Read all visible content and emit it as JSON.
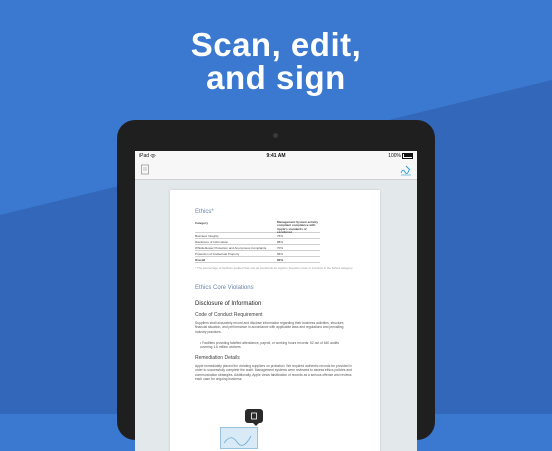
{
  "headline": {
    "line1": "Scan, edit,",
    "line2": "and sign"
  },
  "colors": {
    "background": "#3b78cf",
    "diagonal": "#3368bb",
    "accent": "#2a9fd6"
  },
  "status_bar": {
    "carrier": "iPad",
    "time": "9:41 AM",
    "battery": "100%"
  },
  "toolbar": {
    "left_icon": "document-icon",
    "right_icon": "signature-icon"
  },
  "document": {
    "section_title": "Ethics*",
    "table": {
      "col1_header": "Category",
      "col2_header": "Management System activity compliant compliance with Apple's standards of excellence",
      "rows": [
        {
          "category": "Business Integrity",
          "value": "75%"
        },
        {
          "category": "Disclosure of Information",
          "value": "88%"
        },
        {
          "category": "Whistleblower Protection and Anonymous Complaints",
          "value": "70%"
        },
        {
          "category": "Protection of Intellectual Property",
          "value": "95%"
        },
        {
          "category": "Overall",
          "value": "82%"
        }
      ]
    },
    "footnote": "* The percentage of facilities audited that met all standards for Apple's Supplier Code of Conduct in the Ethics category.",
    "violations_title": "Ethics Core Violations",
    "disclosure_title": "Disclosure of Information",
    "code_title": "Code of Conduct Requirement",
    "code_para": "Suppliers shall accurately record and disclose information regarding their business activities, structure, financial situation, and performance in accordance with applicable laws and regulations and prevailing industry practices.",
    "bullet": "Facilities providing falsified attendance, payroll, or working hours records: 52 out of 640 audits covering 1.6 million workers",
    "remediation_title": "Remediation Details",
    "remediation_para": "Apple immediately placed the violating suppliers on probation. We required authentic records be provided in order to successfully complete the audit. Management systems were reviewed to assess ethics policies and communication strategies. Additionally, Apple views falsification of records as a serious offense and reviews each case for ongoing business."
  }
}
